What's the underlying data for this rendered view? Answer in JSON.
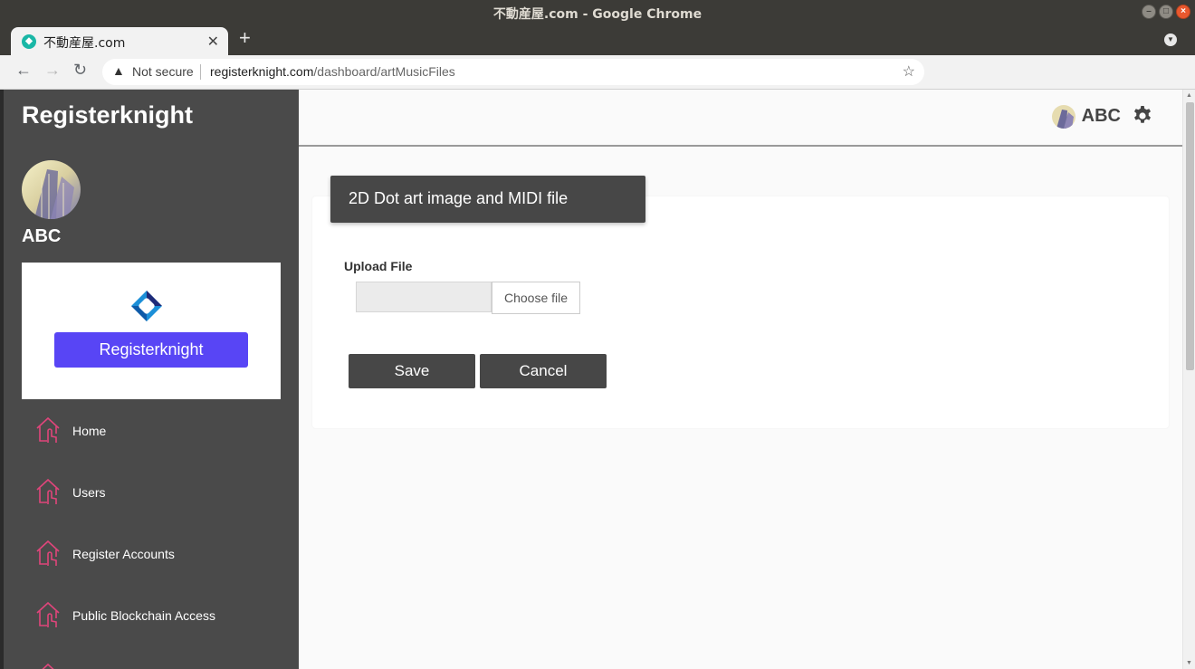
{
  "window": {
    "title": "不動産屋.com - Google Chrome"
  },
  "tab": {
    "title": "不動産屋.com"
  },
  "address_bar": {
    "security_label": "Not secure",
    "url_domain": "registerknight.com",
    "url_path": "/dashboard/artMusicFiles"
  },
  "sidebar": {
    "brand": "Registerknight",
    "user_name": "ABC",
    "promo_button": "Registerknight",
    "items": [
      {
        "label": "Home"
      },
      {
        "label": "Users"
      },
      {
        "label": "Register Accounts"
      },
      {
        "label": "Public Blockchain Access"
      }
    ]
  },
  "header": {
    "user_name": "ABC"
  },
  "form": {
    "title": "2D Dot art image and MIDI file",
    "upload_label": "Upload File",
    "file_button": "Choose file",
    "save_label": "Save",
    "cancel_label": "Cancel"
  },
  "colors": {
    "sidebar_bg": "#4a4a4a",
    "accent": "#5845f5",
    "nav_icon": "#e0457b",
    "button_bg": "#474747"
  }
}
